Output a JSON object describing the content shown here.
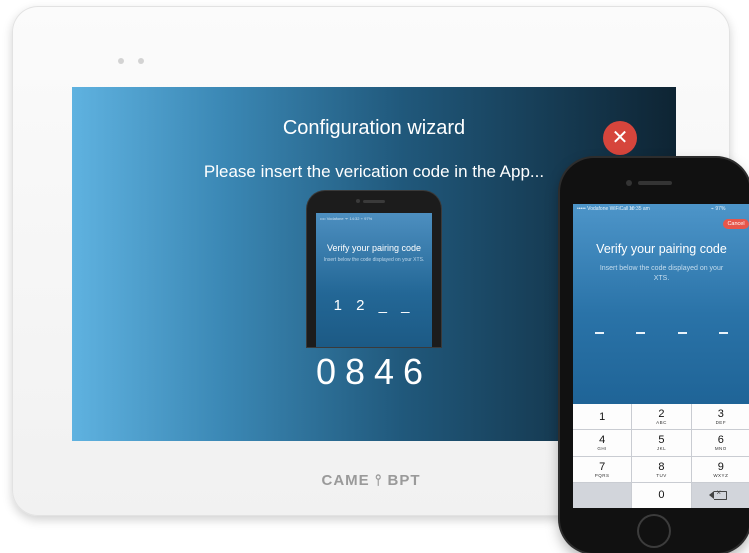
{
  "screen": {
    "title": "Configuration wizard",
    "subtitle": "Please insert the verication code in the App...",
    "close_icon": "close-icon",
    "code": "0846"
  },
  "brand": "CAME ⫯ BPT",
  "mini_phone": {
    "status": "•••• Vodafone  ᯤ    14:32    ⌁ 97%",
    "title": "Verify your pairing code",
    "subtitle": "Insert below the code displayed on your XTS.",
    "digits": "1 2 _ _"
  },
  "phone": {
    "status_left": "••••• Vodafone WiFiCall ᯤ",
    "status_time": "10:35 am",
    "status_right": "⌁ 97%",
    "cancel_label": "Cancel",
    "title": "Verify your pairing code",
    "subtitle": "Insert below the code displayed on your XTS.",
    "keys": [
      {
        "num": "1",
        "letters": ""
      },
      {
        "num": "2",
        "letters": "ABC"
      },
      {
        "num": "3",
        "letters": "DEF"
      },
      {
        "num": "4",
        "letters": "GHI"
      },
      {
        "num": "5",
        "letters": "JKL"
      },
      {
        "num": "6",
        "letters": "MNO"
      },
      {
        "num": "7",
        "letters": "PQRS"
      },
      {
        "num": "8",
        "letters": "TUV"
      },
      {
        "num": "9",
        "letters": "WXYZ"
      },
      {
        "num": "",
        "letters": ""
      },
      {
        "num": "0",
        "letters": ""
      },
      {
        "num": "",
        "letters": ""
      }
    ],
    "backspace_icon": "backspace-icon"
  },
  "colors": {
    "close_red": "#d6453c",
    "cancel_red": "#e8564b",
    "screen_light": "#5fb2e0",
    "screen_dark": "#0e2433"
  }
}
